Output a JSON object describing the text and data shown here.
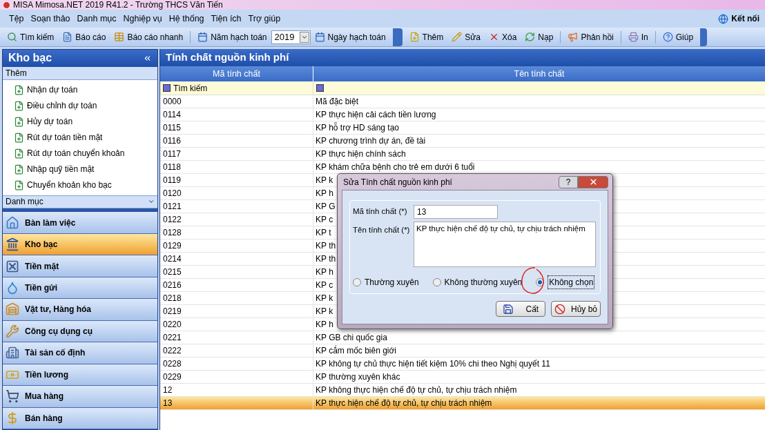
{
  "window": {
    "title": "MISA Mimosa.NET 2019 R41.2 - Trường THCS Văn Tiến"
  },
  "menu": [
    "Tệp",
    "Soạn thảo",
    "Danh mục",
    "Nghiệp vụ",
    "Hệ thống",
    "Tiện ích",
    "Trợ giúp"
  ],
  "connect": "Kết nối",
  "toolbar": [
    {
      "kind": "button",
      "label": "Tìm kiếm"
    },
    {
      "kind": "button",
      "label": "Báo cáo"
    },
    {
      "kind": "button",
      "label": "Báo cáo nhanh"
    },
    {
      "kind": "separator"
    },
    {
      "kind": "button",
      "label": "Năm hạch toán"
    },
    {
      "kind": "combo",
      "value": "2019"
    },
    {
      "kind": "button",
      "label": "Ngày hạch toán"
    },
    {
      "kind": "break"
    },
    {
      "kind": "button",
      "label": "Thêm"
    },
    {
      "kind": "button",
      "label": "Sửa"
    },
    {
      "kind": "button",
      "label": "Xóa"
    },
    {
      "kind": "button",
      "label": "Nạp"
    },
    {
      "kind": "separator"
    },
    {
      "kind": "button",
      "label": "Phản hồi"
    },
    {
      "kind": "separator"
    },
    {
      "kind": "button",
      "label": "In"
    },
    {
      "kind": "separator"
    },
    {
      "kind": "button",
      "label": "Giúp"
    }
  ],
  "sidebar": {
    "title": "Kho bạc",
    "section": "Thêm",
    "items": [
      "Nhận dự toán",
      "Điều chỉnh dự toán",
      "Hủy dự toán",
      "Rút dự toán tiền mặt",
      "Rút dự toán chuyển khoản",
      "Nhập quỹ tiền mặt",
      "Chuyển khoản kho bạc"
    ],
    "dropdown": "Danh mục",
    "nav": [
      {
        "label": "Bàn làm việc",
        "selected": false
      },
      {
        "label": "Kho bạc",
        "selected": true
      },
      {
        "label": "Tiền mặt",
        "selected": false
      },
      {
        "label": "Tiền gửi",
        "selected": false
      },
      {
        "label": "Vật tư, Hàng hóa",
        "selected": false
      },
      {
        "label": "Công cụ dụng cụ",
        "selected": false
      },
      {
        "label": "Tài sản cố định",
        "selected": false
      },
      {
        "label": "Tiền lương",
        "selected": false
      },
      {
        "label": "Mua hàng",
        "selected": false
      },
      {
        "label": "Bán hàng",
        "selected": false
      }
    ]
  },
  "table": {
    "title": "Tính chất nguồn kinh phí",
    "columns": [
      "Mã tính chất",
      "Tên tính chất"
    ],
    "filter": {
      "placeholder": "Tìm kiếm"
    },
    "rows": [
      {
        "code": "0000",
        "name": "Mã đặc biệt",
        "selected": false
      },
      {
        "code": "0114",
        "name": "KP thực hiện cải cách tiền lương",
        "selected": false
      },
      {
        "code": "0115",
        "name": "KP hỗ trợ HD sáng tạo",
        "selected": false
      },
      {
        "code": "0116",
        "name": "KP chương trình dự án, đề tài",
        "selected": false
      },
      {
        "code": "0117",
        "name": "KP thực hiện chính sách",
        "selected": false
      },
      {
        "code": "0118",
        "name": "KP khám chữa bệnh cho trẻ em dưới 6 tuổi",
        "selected": false
      },
      {
        "code": "0119",
        "name": "KP k",
        "selected": false
      },
      {
        "code": "0120",
        "name": "KP h",
        "selected": false
      },
      {
        "code": "0121",
        "name": "KP G",
        "selected": false
      },
      {
        "code": "0122",
        "name": "KP c",
        "selected": false
      },
      {
        "code": "0128",
        "name": "KP t",
        "selected": false
      },
      {
        "code": "0129",
        "name": "KP th",
        "selected": false
      },
      {
        "code": "0214",
        "name": "KP th",
        "selected": false
      },
      {
        "code": "0215",
        "name": "KP h",
        "selected": false
      },
      {
        "code": "0216",
        "name": "KP c",
        "selected": false
      },
      {
        "code": "0218",
        "name": "KP k",
        "selected": false
      },
      {
        "code": "0219",
        "name": "KP k",
        "selected": false
      },
      {
        "code": "0220",
        "name": "KP h",
        "selected": false
      },
      {
        "code": "0221",
        "name": "KP GB chi quốc gia",
        "selected": false
      },
      {
        "code": "0222",
        "name": "KP cắm mốc biên giới",
        "selected": false
      },
      {
        "code": "0228",
        "name": "KP không tự chủ thực hiện tiết kiệm 10% chi theo Nghị quyết 11",
        "selected": false
      },
      {
        "code": "0229",
        "name": "KP thường xuyên khác",
        "selected": false
      },
      {
        "code": "12",
        "name": "KP không thực hiện chế độ tự chủ, tự chịu trách nhiệm",
        "selected": false
      },
      {
        "code": "13",
        "name": "KP thực hiện chế độ tự chủ, tự chịu trách nhiệm",
        "selected": true
      }
    ]
  },
  "dialog": {
    "title": "Sửa Tính chất nguồn kinh phí",
    "help": "?",
    "code_label": "Mã tính chất (*)",
    "code_value": "13",
    "name_label": "Tên tính chất (*)",
    "name_value": "KP thực hiện chế độ tự chủ, tự chịu trách nhiệm",
    "radios": [
      {
        "label": "Thường xuyên",
        "selected": false
      },
      {
        "label": "Không thường xuyên",
        "selected": false
      },
      {
        "label": "Không chọn",
        "selected": true
      }
    ],
    "buttons": [
      {
        "kind": "save",
        "label": "Cất"
      },
      {
        "kind": "cancel",
        "label": "Hủy bỏ"
      }
    ]
  }
}
